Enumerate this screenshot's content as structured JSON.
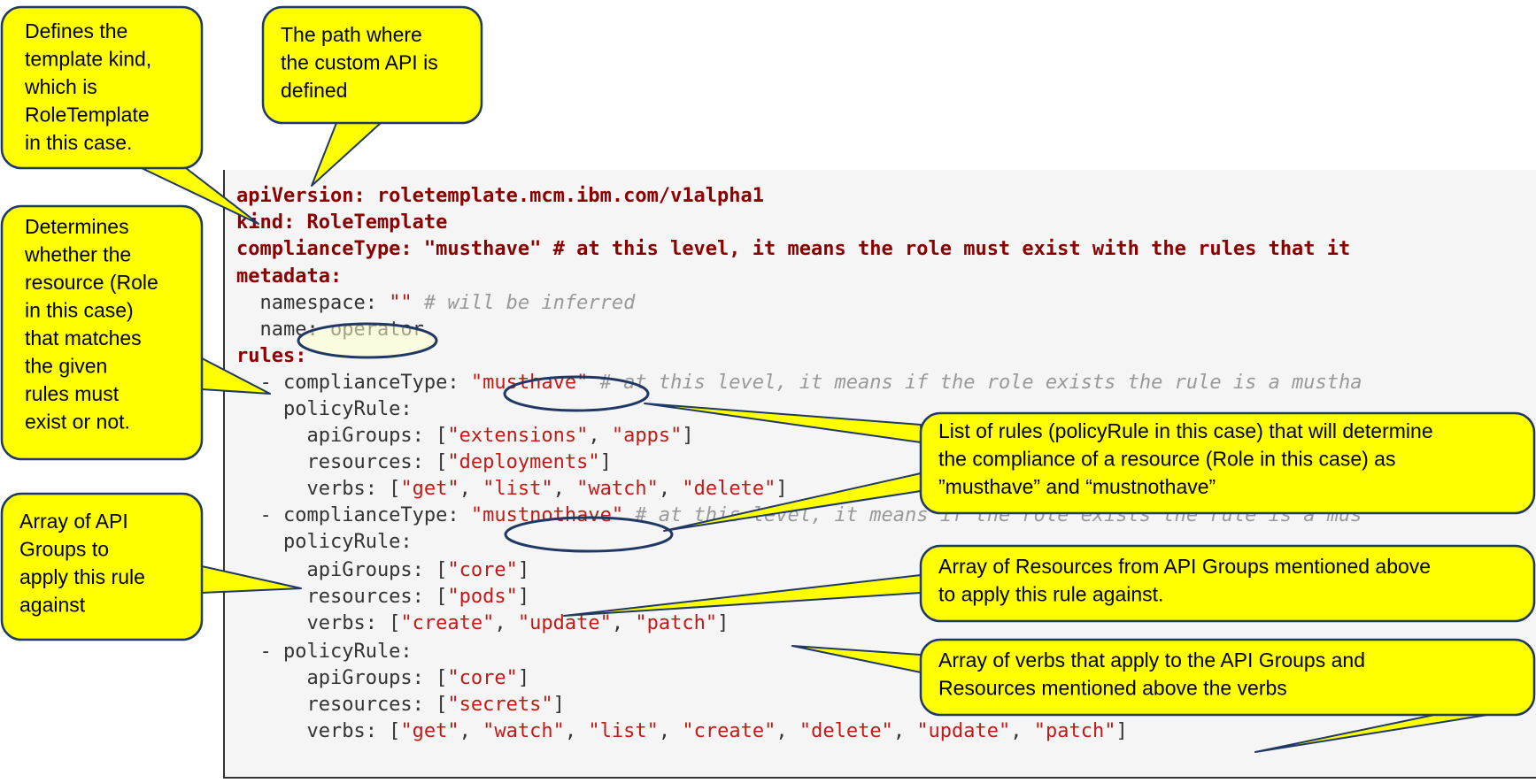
{
  "code": {
    "lines": [
      [
        {
          "t": "apiVersion: roletemplate.mcm.ibm.com/v1alpha1",
          "c": "bold-key"
        }
      ],
      [
        {
          "t": "kind: RoleTemplate",
          "c": "bold-key"
        }
      ],
      [
        {
          "t": "complianceType: \"musthave\" # at this level, it means the role must exist with the rules that it",
          "c": "bold-key"
        }
      ],
      [
        {
          "t": "metadata:",
          "c": "bold-key"
        }
      ],
      [
        {
          "t": "  namespace: ",
          "c": "key"
        },
        {
          "t": "\"\"",
          "c": "str"
        },
        {
          "t": " # will be inferred",
          "c": "comment"
        }
      ],
      [
        {
          "t": "  name: ",
          "c": "key"
        },
        {
          "t": "operator",
          "c": "key"
        }
      ],
      [
        {
          "t": "rules:",
          "c": "bold-key"
        }
      ],
      [
        {
          "t": "  - complianceType: ",
          "c": "key"
        },
        {
          "t": "\"musthave\"",
          "c": "str"
        },
        {
          "t": " # at this level, it means if the role exists the rule is a mustha",
          "c": "comment"
        }
      ],
      [
        {
          "t": "    policyRule:",
          "c": "key"
        }
      ],
      [
        {
          "t": "      apiGroups: [",
          "c": "key"
        },
        {
          "t": "\"extensions\"",
          "c": "str"
        },
        {
          "t": ", ",
          "c": "punc"
        },
        {
          "t": "\"apps\"",
          "c": "str"
        },
        {
          "t": "]",
          "c": "punc"
        }
      ],
      [
        {
          "t": "      resources: [",
          "c": "key"
        },
        {
          "t": "\"deployments\"",
          "c": "str"
        },
        {
          "t": "]",
          "c": "punc"
        }
      ],
      [
        {
          "t": "      verbs: [",
          "c": "key"
        },
        {
          "t": "\"get\"",
          "c": "str"
        },
        {
          "t": ", ",
          "c": "punc"
        },
        {
          "t": "\"list\"",
          "c": "str"
        },
        {
          "t": ", ",
          "c": "punc"
        },
        {
          "t": "\"watch\"",
          "c": "str"
        },
        {
          "t": ", ",
          "c": "punc"
        },
        {
          "t": "\"delete\"",
          "c": "str"
        },
        {
          "t": "]",
          "c": "punc"
        }
      ],
      [
        {
          "t": "  - complianceType: ",
          "c": "key"
        },
        {
          "t": "\"mustnothave\"",
          "c": "str"
        },
        {
          "t": " # at this level, it means if the role exists the rule is a mus",
          "c": "comment"
        }
      ],
      [
        {
          "t": "    policyRule:",
          "c": "key"
        }
      ],
      [
        {
          "t": "      apiGroups: [",
          "c": "key"
        },
        {
          "t": "\"core\"",
          "c": "str"
        },
        {
          "t": "]",
          "c": "punc"
        }
      ],
      [
        {
          "t": "      resources: [",
          "c": "key"
        },
        {
          "t": "\"pods\"",
          "c": "str"
        },
        {
          "t": "]",
          "c": "punc"
        }
      ],
      [
        {
          "t": "      verbs: [",
          "c": "key"
        },
        {
          "t": "\"create\"",
          "c": "str"
        },
        {
          "t": ", ",
          "c": "punc"
        },
        {
          "t": "\"update\"",
          "c": "str"
        },
        {
          "t": ", ",
          "c": "punc"
        },
        {
          "t": "\"patch\"",
          "c": "str"
        },
        {
          "t": "]",
          "c": "punc"
        }
      ],
      [
        {
          "t": "  - policyRule:",
          "c": "key"
        }
      ],
      [
        {
          "t": "      apiGroups: [",
          "c": "key"
        },
        {
          "t": "\"core\"",
          "c": "str"
        },
        {
          "t": "]",
          "c": "punc"
        }
      ],
      [
        {
          "t": "      resources: [",
          "c": "key"
        },
        {
          "t": "\"secrets\"",
          "c": "str"
        },
        {
          "t": "]",
          "c": "punc"
        }
      ],
      [
        {
          "t": "      verbs: [",
          "c": "key"
        },
        {
          "t": "\"get\"",
          "c": "str"
        },
        {
          "t": ", ",
          "c": "punc"
        },
        {
          "t": "\"watch\"",
          "c": "str"
        },
        {
          "t": ", ",
          "c": "punc"
        },
        {
          "t": "\"list\"",
          "c": "str"
        },
        {
          "t": ", ",
          "c": "punc"
        },
        {
          "t": "\"create\"",
          "c": "str"
        },
        {
          "t": ", ",
          "c": "punc"
        },
        {
          "t": "\"delete\"",
          "c": "str"
        },
        {
          "t": ", ",
          "c": "punc"
        },
        {
          "t": "\"update\"",
          "c": "str"
        },
        {
          "t": ", ",
          "c": "punc"
        },
        {
          "t": "\"patch\"",
          "c": "str"
        },
        {
          "t": "]",
          "c": "punc"
        }
      ]
    ]
  },
  "callouts": {
    "template_kind": [
      "Defines the",
      "template kind,",
      "which is",
      "RoleTemplate",
      "in this case."
    ],
    "api_path": [
      "The path where",
      "the custom API is",
      "defined"
    ],
    "compliance": [
      "Determines",
      "whether the",
      "resource (Role",
      "in this case)",
      "that matches",
      "the given",
      "rules must",
      "exist or not."
    ],
    "api_groups": [
      "Array of API",
      "Groups to",
      "apply this rule",
      "against"
    ],
    "rules_list": [
      "List of rules (policyRule in this case) that will determine",
      "the compliance of a resource (Role in this case) as",
      "”musthave” and “mustnothave”"
    ],
    "resources": [
      "Array of Resources from API Groups mentioned above",
      "to apply this rule against."
    ],
    "verbs": [
      "Array of verbs that apply to the API Groups and",
      "Resources mentioned above the verbs"
    ]
  },
  "colors": {
    "callout_fill": "#ffff00",
    "callout_stroke": "#1f3864",
    "highlight_fill": "#ffffcc",
    "code_background": "#f5f5f5"
  }
}
